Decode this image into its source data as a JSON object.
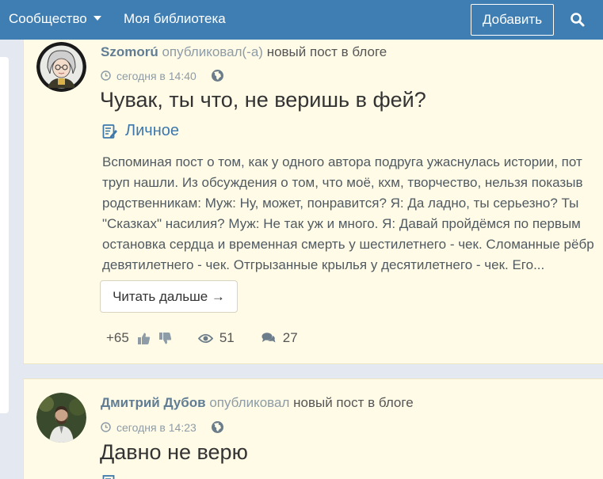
{
  "nav": {
    "community": "Сообщество",
    "library": "Моя библиотека",
    "add_button": "Добавить"
  },
  "posts": [
    {
      "author": "Szomorú",
      "published_verb": "опубликовал(-а)",
      "action_rest": "новый пост в блоге",
      "date": "сегодня в 14:40",
      "title": "Чувак, ты что, не веришь в фей?",
      "category": "Личное",
      "excerpt_lines": [
        "Вспоминая пост о том, как у одного автора подруга ужаснулась истории, пот",
        "труп нашли. Из обсуждения о том, что моё, кхм, творчество, нельзя показыв",
        "родственникам: Муж: Ну, может, понравится? Я: Да ладно, ты серьезно? Ты",
        "\"Сказках\" насилия? Муж: Не так уж и много. Я: Давай пройдёмся по первым",
        "остановка сердца и временная смерть у шестилетнего - чек. Сломанные рёбр",
        "девятилетнего - чек. Отгрызанные крылья у десятилетнего - чек. Его..."
      ],
      "read_more": "Читать дальше →",
      "rating": "+65",
      "views": "51",
      "comments": "27"
    },
    {
      "author": "Дмитрий Дубов",
      "published_verb": "опубликовал",
      "action_rest": "новый пост в блоге",
      "date": "сегодня в 14:23",
      "title": "Давно не верю"
    }
  ],
  "colors": {
    "header": "#3f7eb3",
    "card_bg": "#fffbe6",
    "author": "#607d94",
    "link": "#3d78ad"
  }
}
